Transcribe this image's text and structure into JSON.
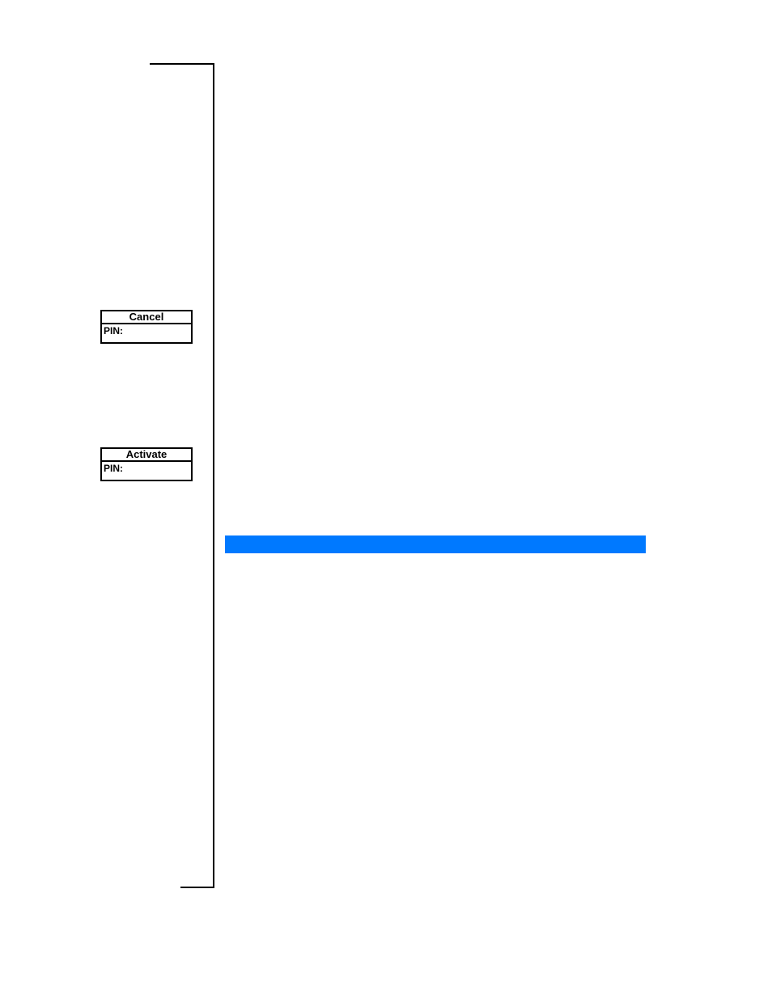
{
  "boxes": {
    "cancel": {
      "header": "Cancel",
      "field_label": "PIN:"
    },
    "activate": {
      "header": "Activate",
      "field_label": "PIN:"
    }
  }
}
